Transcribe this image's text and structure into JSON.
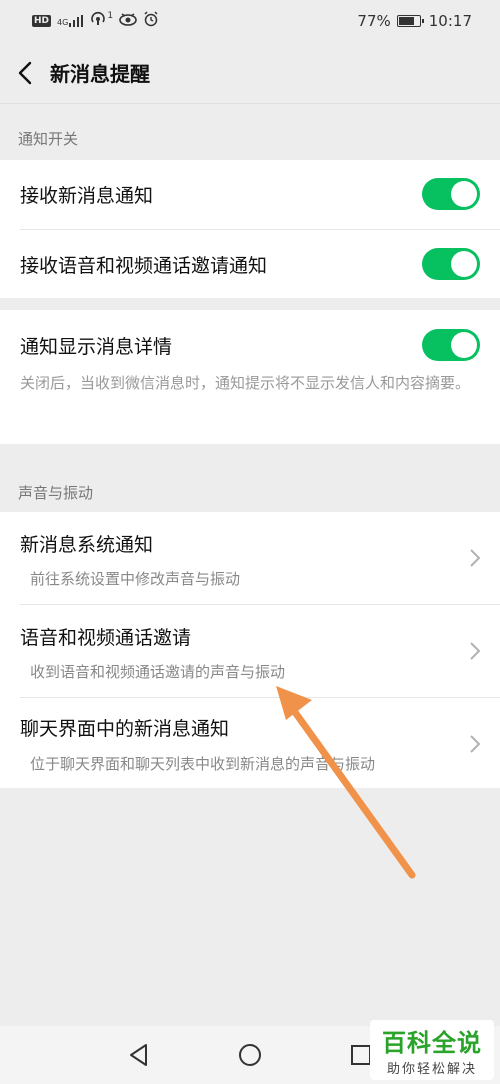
{
  "status_bar": {
    "hd": "HD",
    "network": "4G",
    "signal_sup": "1",
    "battery_percent": "77%",
    "battery_level": 0.77,
    "time": "10:17"
  },
  "nav": {
    "title": "新消息提醒"
  },
  "sections": {
    "notify_switch": {
      "header": "通知开关",
      "receive_new": "接收新消息通知",
      "receive_call": "接收语音和视频通话邀请通知",
      "show_details": "通知显示消息详情",
      "show_details_desc": "关闭后，当收到微信消息时，通知提示将不显示发信人和内容摘要。"
    },
    "sound_vibration": {
      "header": "声音与振动",
      "items": [
        {
          "title": "新消息系统通知",
          "subtitle": "前往系统设置中修改声音与振动"
        },
        {
          "title": "语音和视频通话邀请",
          "subtitle": "收到语音和视频通话邀请的声音与振动"
        },
        {
          "title": "聊天界面中的新消息通知",
          "subtitle": "位于聊天界面和聊天列表中收到新消息的声音与振动"
        }
      ]
    }
  },
  "toggles": {
    "receive_new": true,
    "receive_call": true,
    "show_details": true
  },
  "colors": {
    "toggle_on": "#07c160",
    "annotation_arrow": "#f0924a",
    "watermark": "#29a329"
  },
  "watermark": {
    "main": "百科全说",
    "sub": "助你轻松解决"
  },
  "icons": {
    "back": "chevron-left-icon",
    "row_chevron": "chevron-right-icon",
    "sys_back": "triangle-back-icon",
    "sys_home": "circle-home-icon",
    "sys_recent": "square-recent-icon"
  }
}
